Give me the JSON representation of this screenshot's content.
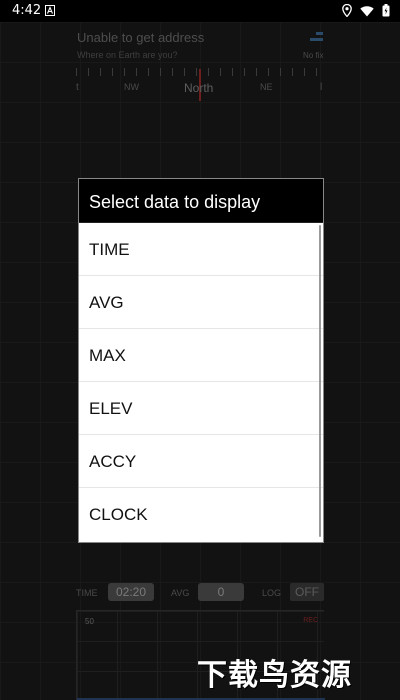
{
  "status_bar": {
    "time": "4:42",
    "icons": [
      "notification-a-icon",
      "location-icon",
      "wifi-icon",
      "battery-icon"
    ]
  },
  "header": {
    "address_title": "Unable to get address",
    "address_subtitle": "Where on Earth are you?",
    "fix_status": "No fix"
  },
  "compass": {
    "labels": [
      "t",
      "NW",
      "North",
      "NE",
      "l"
    ],
    "needle_color": "#6d1f1f"
  },
  "stats": {
    "time_label": "TIME",
    "time_value": "02:20",
    "avg_label": "AVG",
    "avg_value": "0",
    "log_label": "LOG",
    "log_value": "OFF"
  },
  "graph": {
    "y_label": "50",
    "rec_label": "REC"
  },
  "dialog": {
    "title": "Select data to display",
    "items": [
      "TIME",
      "AVG",
      "MAX",
      "ELEV",
      "ACCY",
      "CLOCK"
    ]
  },
  "watermark": "下载鸟资源",
  "colors": {
    "background": "#121212",
    "dialog_header": "#000000",
    "dialog_body": "#ffffff"
  }
}
